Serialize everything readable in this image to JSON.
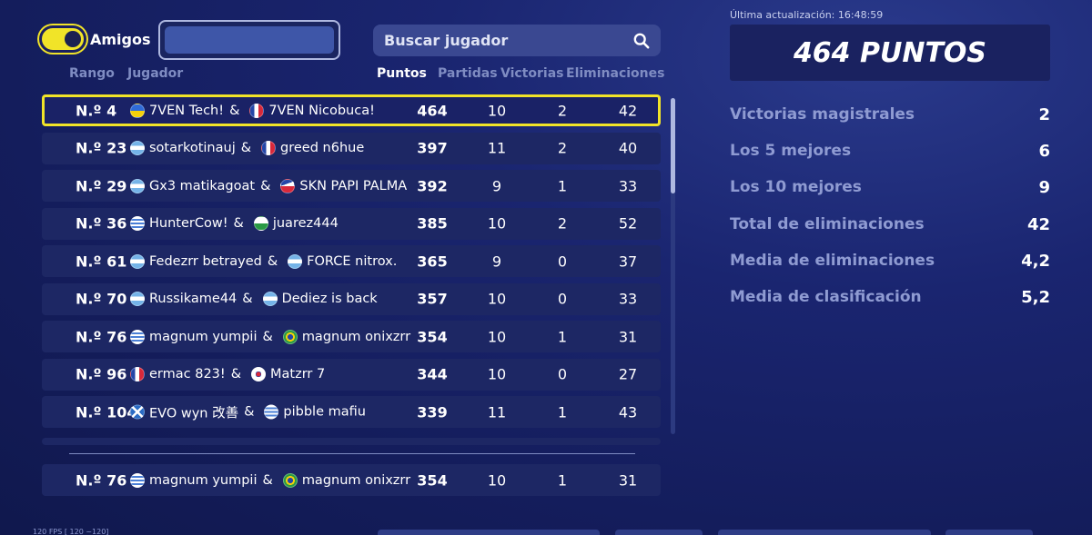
{
  "header": {
    "friends_label": "Amigos",
    "search_placeholder": "Buscar jugador",
    "columns": {
      "rank": "Rango",
      "player": "Jugador",
      "points": "Puntos",
      "matches": "Partidas",
      "wins": "Victorias",
      "eliminations": "Eliminaciones"
    }
  },
  "leaderboard": {
    "rows": [
      {
        "rank": "N.º 4",
        "p1_flag": "ukraine-flag",
        "p1": "7VEN Tech!",
        "p2_flag": "france-flag",
        "p2": "7VEN Nicobuca!",
        "points": "464",
        "matches": "10",
        "wins": "2",
        "elims": "42"
      },
      {
        "rank": "N.º 23",
        "p1_flag": "argentina-flag",
        "p1": "sotarkotinauj",
        "p2_flag": "france-flag",
        "p2": "greed n6hue",
        "points": "397",
        "matches": "11",
        "wins": "2",
        "elims": "40"
      },
      {
        "rank": "N.º 29",
        "p1_flag": "argentina-flag",
        "p1": "Gx3 matikagoat",
        "p2_flag": "czech-flag",
        "p2": "SKN PAPI PALMA",
        "points": "392",
        "matches": "9",
        "wins": "1",
        "elims": "33"
      },
      {
        "rank": "N.º 36",
        "p1_flag": "uruguay-flag",
        "p1": "HunterCow!",
        "p2_flag": "wales-flag",
        "p2": "juarez444",
        "points": "385",
        "matches": "10",
        "wins": "2",
        "elims": "52"
      },
      {
        "rank": "N.º 61",
        "p1_flag": "argentina-flag",
        "p1": "Fedezrr betrayed",
        "p2_flag": "argentina-flag",
        "p2": "FORCE nitrox.",
        "points": "365",
        "matches": "9",
        "wins": "0",
        "elims": "37"
      },
      {
        "rank": "N.º 70",
        "p1_flag": "argentina-flag",
        "p1": "Russikame44",
        "p2_flag": "argentina-flag",
        "p2": "Dediez is back",
        "points": "357",
        "matches": "10",
        "wins": "0",
        "elims": "33"
      },
      {
        "rank": "N.º 76",
        "p1_flag": "uruguay-flag",
        "p1": "magnum yumpii",
        "p2_flag": "brazil-flag",
        "p2": "magnum onixzrr",
        "points": "354",
        "matches": "10",
        "wins": "1",
        "elims": "31"
      },
      {
        "rank": "N.º 96",
        "p1_flag": "france-flag",
        "p1": "ermac 823!",
        "p2_flag": "korea-flag",
        "p2": "Matzrr 7",
        "points": "344",
        "matches": "10",
        "wins": "0",
        "elims": "27"
      },
      {
        "rank": "N.º 104",
        "p1_flag": "scotland-flag",
        "p1": "EVO wyn 改善",
        "p2_flag": "uruguay-flag",
        "p2": "pibble mafiu",
        "points": "339",
        "matches": "11",
        "wins": "1",
        "elims": "43"
      }
    ],
    "own_row": {
      "rank": "N.º 76",
      "p1_flag": "uruguay-flag",
      "p1": "magnum yumpii",
      "p2_flag": "brazil-flag",
      "p2": "magnum onixzrr",
      "points": "354",
      "matches": "10",
      "wins": "1",
      "elims": "31"
    }
  },
  "stats_panel": {
    "updated": "Última actualización: 16:48:59",
    "points_title": "464 PUNTOS",
    "stats": [
      {
        "label": "Victorias magistrales",
        "value": "2"
      },
      {
        "label": "Los 5 mejores",
        "value": "6"
      },
      {
        "label": "Los 10 mejores",
        "value": "9"
      },
      {
        "label": "Total de eliminaciones",
        "value": "42"
      },
      {
        "label": "Media de eliminaciones",
        "value": "4,2"
      },
      {
        "label": "Media de clasificación",
        "value": "5,2"
      }
    ]
  },
  "footer": {
    "fps": "120 FPS [ 120 ~120]"
  },
  "colors": {
    "accent": "#f1e428",
    "background": "#141d5c",
    "row": "#1d2764",
    "muted": "#8f9bd2"
  }
}
